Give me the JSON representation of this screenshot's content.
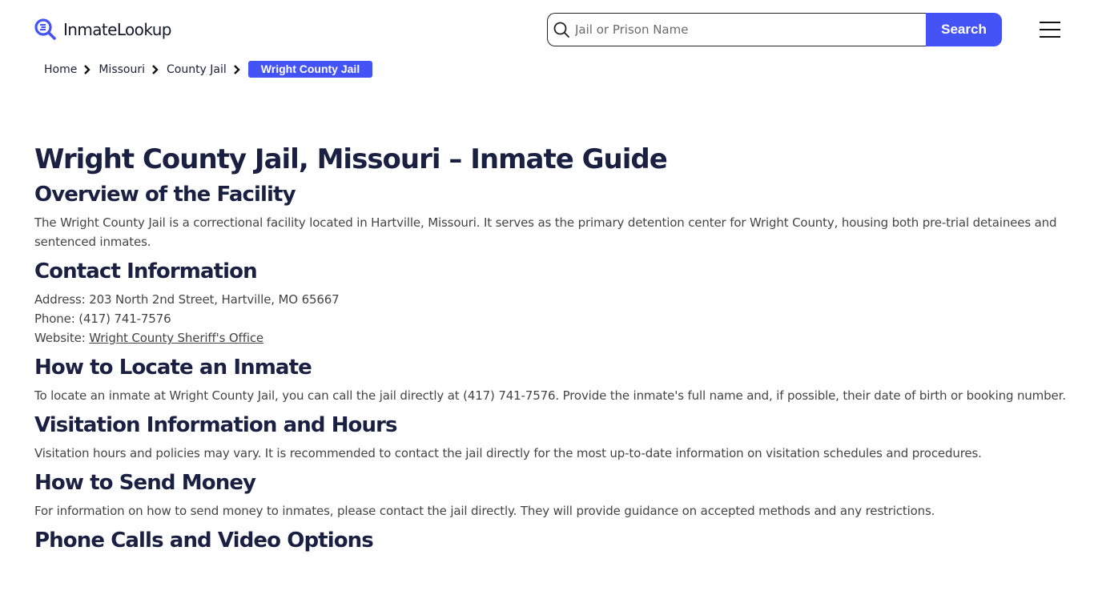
{
  "header": {
    "logo_text": "InmateLookup",
    "search": {
      "placeholder": "Jail or Prison Name",
      "value": "",
      "button_label": "Search"
    },
    "colors": {
      "accent": "#4353f5",
      "heading": "#1a2042",
      "body_text": "#444444"
    }
  },
  "breadcrumb": {
    "items": [
      "Home",
      "Missouri",
      "County Jail"
    ],
    "current": "Wright County Jail"
  },
  "page": {
    "title": "Wright County Jail, Missouri – Inmate Guide",
    "sections": [
      {
        "heading": "Overview of the Facility",
        "body": "The Wright County Jail is a correctional facility located in Hartville, Missouri. It serves as the primary detention center for Wright County, housing both pre-trial detainees and sentenced inmates."
      },
      {
        "heading": "Contact Information",
        "address_label": "Address:",
        "address": "203 North 2nd Street, Hartville, MO 65667",
        "phone_label": "Phone:",
        "phone": "(417) 741-7576",
        "website_label": "Website:",
        "website_link": "Wright County Sheriff's Office"
      },
      {
        "heading": "How to Locate an Inmate",
        "body": "To locate an inmate at Wright County Jail, you can call the jail directly at (417) 741-7576. Provide the inmate's full name and, if possible, their date of birth or booking number."
      },
      {
        "heading": "Visitation Information and Hours",
        "body": "Visitation hours and policies may vary. It is recommended to contact the jail directly for the most up-to-date information on visitation schedules and procedures."
      },
      {
        "heading": "How to Send Money",
        "body": "For information on how to send money to inmates, please contact the jail directly. They will provide guidance on accepted methods and any restrictions."
      },
      {
        "heading": "Phone Calls and Video Options"
      }
    ]
  }
}
